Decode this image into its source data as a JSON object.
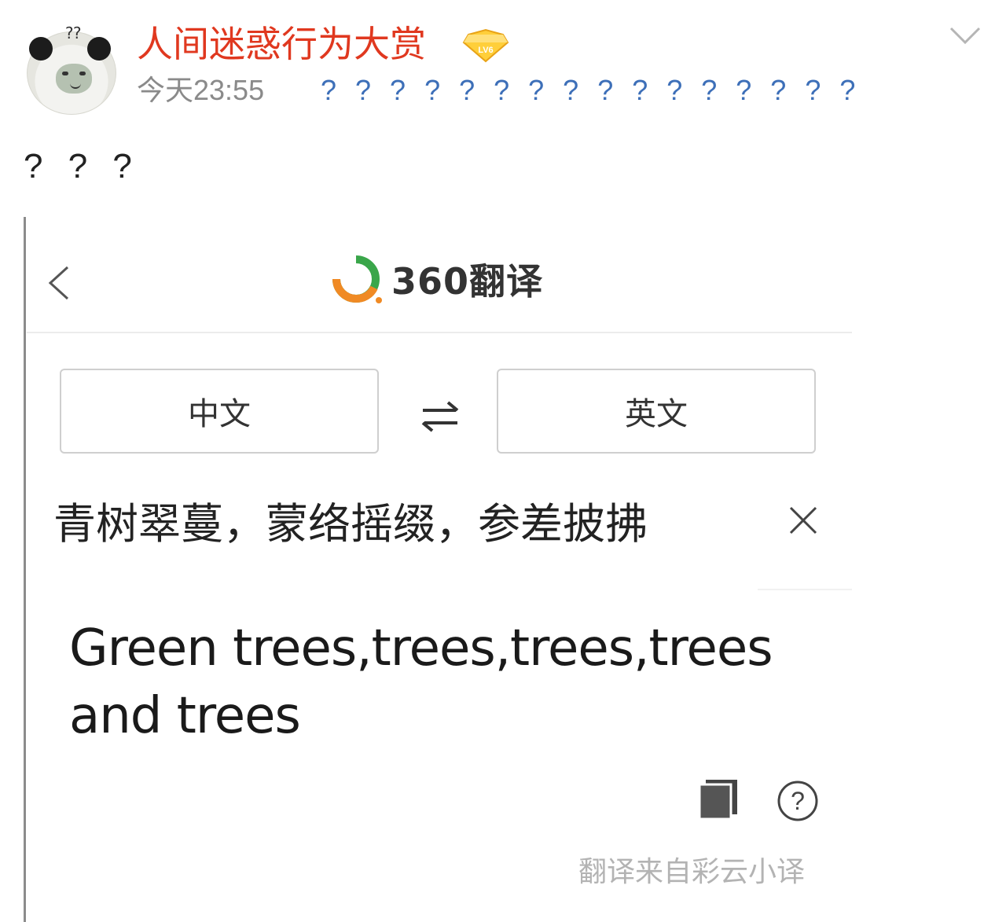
{
  "post": {
    "username": "人间迷惑行为大赏",
    "level_badge": "LV6",
    "timestamp": "今天23:55",
    "source": "? ? ? ? ? ? ? ? ? ? ? ? ? ? ? ?",
    "text": "? ? ?"
  },
  "embed": {
    "app_name": "360翻译",
    "source_lang": "中文",
    "target_lang": "英文",
    "input_text": "青树翠蔓，蒙络摇缀，参差披拂",
    "output_text": "Green trees,trees,trees,trees and trees",
    "attribution": "翻译来自彩云小译"
  },
  "colors": {
    "username": "#e0381f",
    "source": "#3d6fb8",
    "logo_green": "#3aa64a",
    "logo_orange": "#f08a24"
  }
}
